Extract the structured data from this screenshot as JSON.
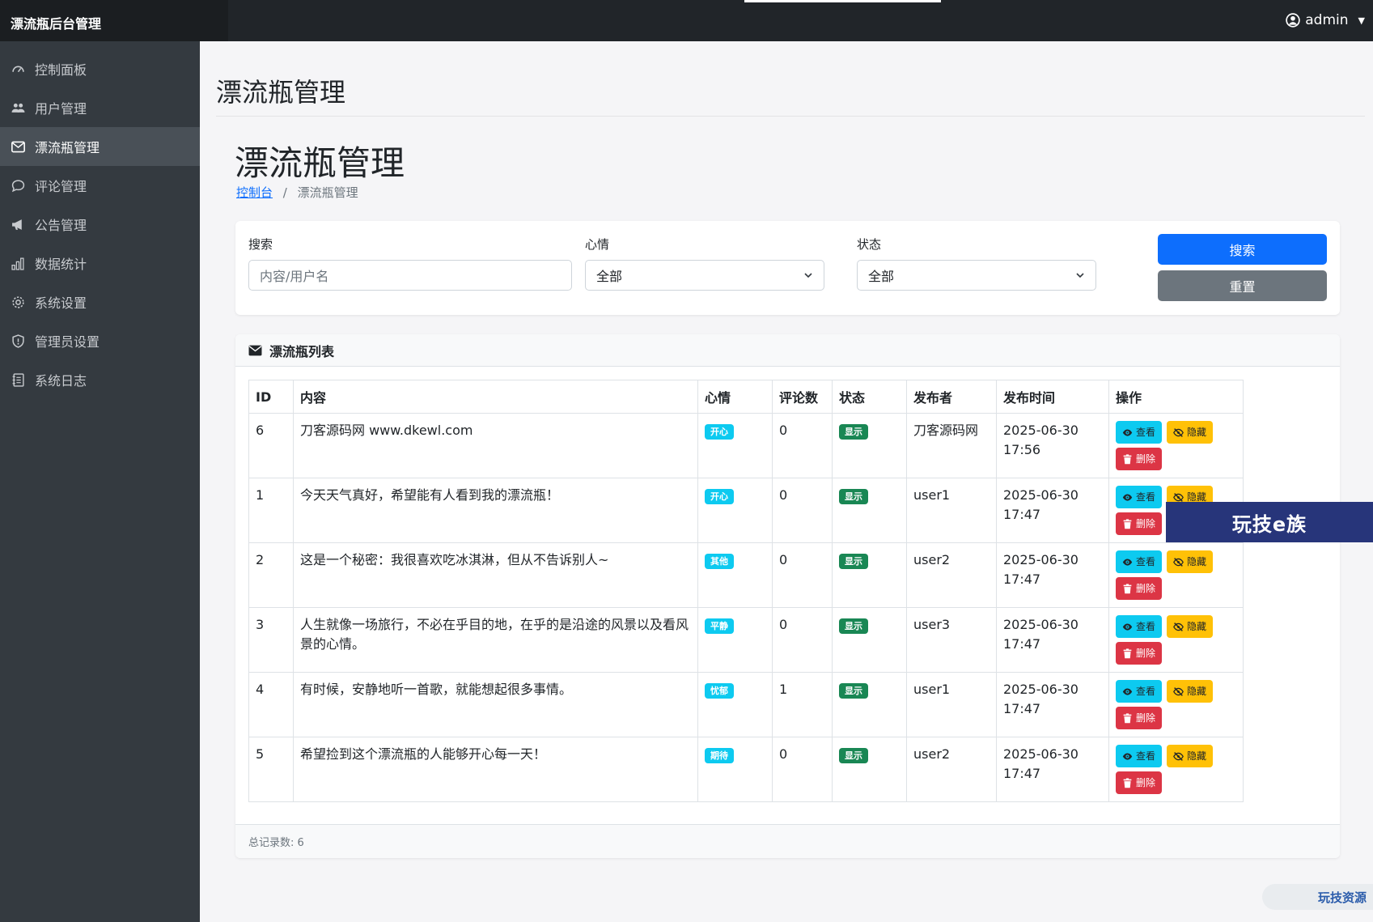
{
  "app": {
    "brand": "漂流瓶后台管理",
    "user": "admin"
  },
  "sidebar": {
    "items": [
      {
        "label": "控制面板",
        "icon": "speedometer-icon"
      },
      {
        "label": "用户管理",
        "icon": "people-icon"
      },
      {
        "label": "漂流瓶管理",
        "icon": "envelope-icon",
        "active": true
      },
      {
        "label": "评论管理",
        "icon": "chat-icon"
      },
      {
        "label": "公告管理",
        "icon": "megaphone-icon"
      },
      {
        "label": "数据统计",
        "icon": "bar-chart-icon"
      },
      {
        "label": "系统设置",
        "icon": "gear-icon"
      },
      {
        "label": "管理员设置",
        "icon": "shield-icon"
      },
      {
        "label": "系统日志",
        "icon": "journal-icon"
      }
    ]
  },
  "page": {
    "header": "漂流瓶管理",
    "title": "漂流瓶管理",
    "breadcrumb": {
      "home": "控制台",
      "separator": "/",
      "current": "漂流瓶管理"
    }
  },
  "filter": {
    "search_label": "搜索",
    "search_placeholder": "内容/用户名",
    "mood_label": "心情",
    "mood_value": "全部",
    "status_label": "状态",
    "status_value": "全部",
    "search_button": "搜索",
    "reset_button": "重置"
  },
  "list": {
    "title": "漂流瓶列表",
    "columns": [
      "ID",
      "内容",
      "心情",
      "评论数",
      "状态",
      "发布者",
      "发布时间",
      "操作"
    ],
    "actions": {
      "view": "查看",
      "hide": "隐藏",
      "delete": "删除"
    },
    "rows": [
      {
        "id": "6",
        "content": "刀客源码网 www.dkewl.com",
        "mood": "开心",
        "comments": "0",
        "status": "显示",
        "author": "刀客源码网",
        "date": "2025-06-30",
        "time": "17:56"
      },
      {
        "id": "1",
        "content": "今天天气真好，希望能有人看到我的漂流瓶！",
        "mood": "开心",
        "comments": "0",
        "status": "显示",
        "author": "user1",
        "date": "2025-06-30",
        "time": "17:47"
      },
      {
        "id": "2",
        "content": "这是一个秘密：我很喜欢吃冰淇淋，但从不告诉别人~",
        "mood": "其他",
        "comments": "0",
        "status": "显示",
        "author": "user2",
        "date": "2025-06-30",
        "time": "17:47"
      },
      {
        "id": "3",
        "content": "人生就像一场旅行，不必在乎目的地，在乎的是沿途的风景以及看风景的心情。",
        "mood": "平静",
        "comments": "0",
        "status": "显示",
        "author": "user3",
        "date": "2025-06-30",
        "time": "17:47"
      },
      {
        "id": "4",
        "content": "有时候，安静地听一首歌，就能想起很多事情。",
        "mood": "忧郁",
        "comments": "1",
        "status": "显示",
        "author": "user1",
        "date": "2025-06-30",
        "time": "17:47"
      },
      {
        "id": "5",
        "content": "希望捡到这个漂流瓶的人能够开心每一天！",
        "mood": "期待",
        "comments": "0",
        "status": "显示",
        "author": "user2",
        "date": "2025-06-30",
        "time": "17:47"
      }
    ],
    "footer": "总记录数: 6"
  },
  "watermarks": {
    "overlay": "玩技e族",
    "corner": "玩技资源"
  },
  "colors": {
    "primary": "#0d6efd",
    "secondary": "#6c757d",
    "info": "#0dcaf0",
    "warning": "#ffc107",
    "danger": "#dc3545",
    "success": "#198754",
    "sidebar": "#343a40"
  }
}
